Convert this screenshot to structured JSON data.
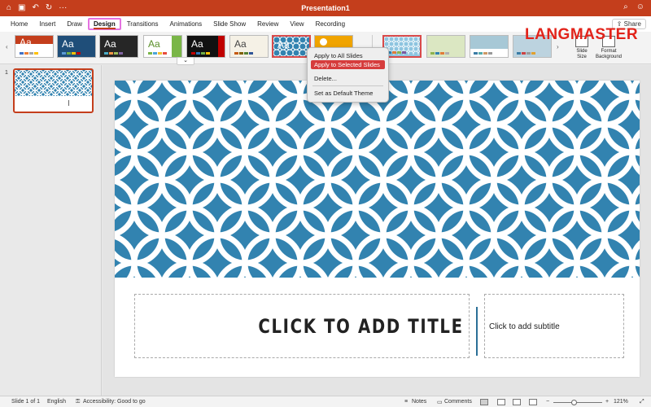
{
  "titlebar": {
    "title": "Presentation1",
    "qa_icons": [
      "home-icon",
      "save-icon",
      "undo-icon",
      "redo-icon",
      "more-icon"
    ],
    "right_icons": [
      "search-icon",
      "profile-icon"
    ]
  },
  "tabs": [
    "Home",
    "Insert",
    "Draw",
    "Design",
    "Transitions",
    "Animations",
    "Slide Show",
    "Review",
    "View",
    "Recording"
  ],
  "active_tab": "Design",
  "share_label": "Share",
  "brand": "LANGMASTER",
  "ribbon": {
    "theme_label": "Aa",
    "slide_size_label": "Slide Size",
    "format_background_label": "Format Background"
  },
  "context_menu": {
    "items": [
      "Apply to All Slides",
      "Apply to Selected Slides",
      "Delete...",
      "Set as Default Theme"
    ],
    "highlighted": "Apply to Selected Slides"
  },
  "slide_panel": {
    "slide_number": "1"
  },
  "slide": {
    "title": "CLICK TO ADD TITLE",
    "subtitle": "Click to add subtitle",
    "pattern_color": "#3283b0"
  },
  "status": {
    "slide_count": "Slide 1 of 1",
    "language": "English",
    "accessibility": "Accessibility: Good to go",
    "notes": "Notes",
    "comments": "Comments",
    "zoom": "121%"
  },
  "colors": {
    "accent": "#c43e1c",
    "menu_highlight": "#d63c3c",
    "tab_highlight_border": "#e572e1",
    "brand": "#e2231a"
  }
}
